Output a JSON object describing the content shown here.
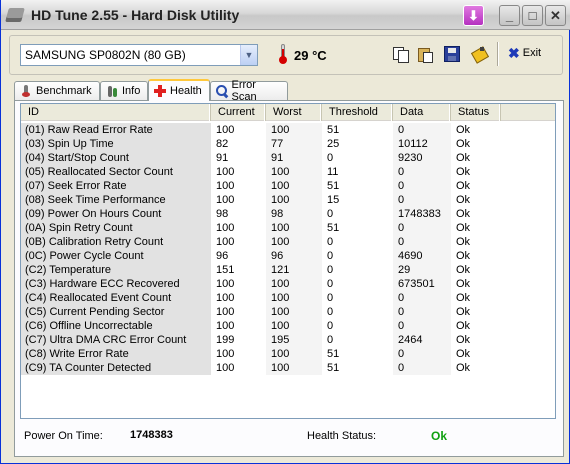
{
  "window": {
    "title": "HD Tune 2.55 - Hard Disk Utility"
  },
  "toolbar": {
    "drive": "SAMSUNG SP0802N (80 GB)",
    "temperature": "29 °C",
    "exit_label": "Exit"
  },
  "tabs": [
    {
      "label": "Benchmark",
      "icon": "benchmark-icon"
    },
    {
      "label": "Info",
      "icon": "info-icon"
    },
    {
      "label": "Health",
      "icon": "health-icon",
      "active": true
    },
    {
      "label": "Error Scan",
      "icon": "search-icon"
    }
  ],
  "table": {
    "headers": {
      "id": "ID",
      "current": "Current",
      "worst": "Worst",
      "threshold": "Threshold",
      "data": "Data",
      "status": "Status"
    },
    "rows": [
      {
        "id": "(01) Raw Read Error Rate",
        "current": "100",
        "worst": "100",
        "threshold": "51",
        "data": "0",
        "status": "Ok"
      },
      {
        "id": "(03) Spin Up Time",
        "current": "82",
        "worst": "77",
        "threshold": "25",
        "data": "10112",
        "status": "Ok"
      },
      {
        "id": "(04) Start/Stop Count",
        "current": "91",
        "worst": "91",
        "threshold": "0",
        "data": "9230",
        "status": "Ok"
      },
      {
        "id": "(05) Reallocated Sector Count",
        "current": "100",
        "worst": "100",
        "threshold": "11",
        "data": "0",
        "status": "Ok"
      },
      {
        "id": "(07) Seek Error Rate",
        "current": "100",
        "worst": "100",
        "threshold": "51",
        "data": "0",
        "status": "Ok"
      },
      {
        "id": "(08) Seek Time Performance",
        "current": "100",
        "worst": "100",
        "threshold": "15",
        "data": "0",
        "status": "Ok"
      },
      {
        "id": "(09) Power On Hours Count",
        "current": "98",
        "worst": "98",
        "threshold": "0",
        "data": "1748383",
        "status": "Ok"
      },
      {
        "id": "(0A) Spin Retry Count",
        "current": "100",
        "worst": "100",
        "threshold": "51",
        "data": "0",
        "status": "Ok"
      },
      {
        "id": "(0B) Calibration Retry Count",
        "current": "100",
        "worst": "100",
        "threshold": "0",
        "data": "0",
        "status": "Ok"
      },
      {
        "id": "(0C) Power Cycle Count",
        "current": "96",
        "worst": "96",
        "threshold": "0",
        "data": "4690",
        "status": "Ok"
      },
      {
        "id": "(C2) Temperature",
        "current": "151",
        "worst": "121",
        "threshold": "0",
        "data": "29",
        "status": "Ok"
      },
      {
        "id": "(C3) Hardware ECC Recovered",
        "current": "100",
        "worst": "100",
        "threshold": "0",
        "data": "673501",
        "status": "Ok"
      },
      {
        "id": "(C4) Reallocated Event Count",
        "current": "100",
        "worst": "100",
        "threshold": "0",
        "data": "0",
        "status": "Ok"
      },
      {
        "id": "(C5) Current Pending Sector",
        "current": "100",
        "worst": "100",
        "threshold": "0",
        "data": "0",
        "status": "Ok"
      },
      {
        "id": "(C6) Offline Uncorrectable",
        "current": "100",
        "worst": "100",
        "threshold": "0",
        "data": "0",
        "status": "Ok"
      },
      {
        "id": "(C7) Ultra DMA CRC Error Count",
        "current": "199",
        "worst": "195",
        "threshold": "0",
        "data": "2464",
        "status": "Ok"
      },
      {
        "id": "(C8) Write Error Rate",
        "current": "100",
        "worst": "100",
        "threshold": "51",
        "data": "0",
        "status": "Ok"
      },
      {
        "id": "(C9) TA Counter Detected",
        "current": "100",
        "worst": "100",
        "threshold": "51",
        "data": "0",
        "status": "Ok"
      }
    ]
  },
  "footer": {
    "power_on_label": "Power On Time:",
    "power_on_value": "1748383",
    "health_label": "Health Status:",
    "health_value": "Ok"
  },
  "colors": {
    "health_ok": "#10a010",
    "title_bar_button": "#b530c0"
  }
}
